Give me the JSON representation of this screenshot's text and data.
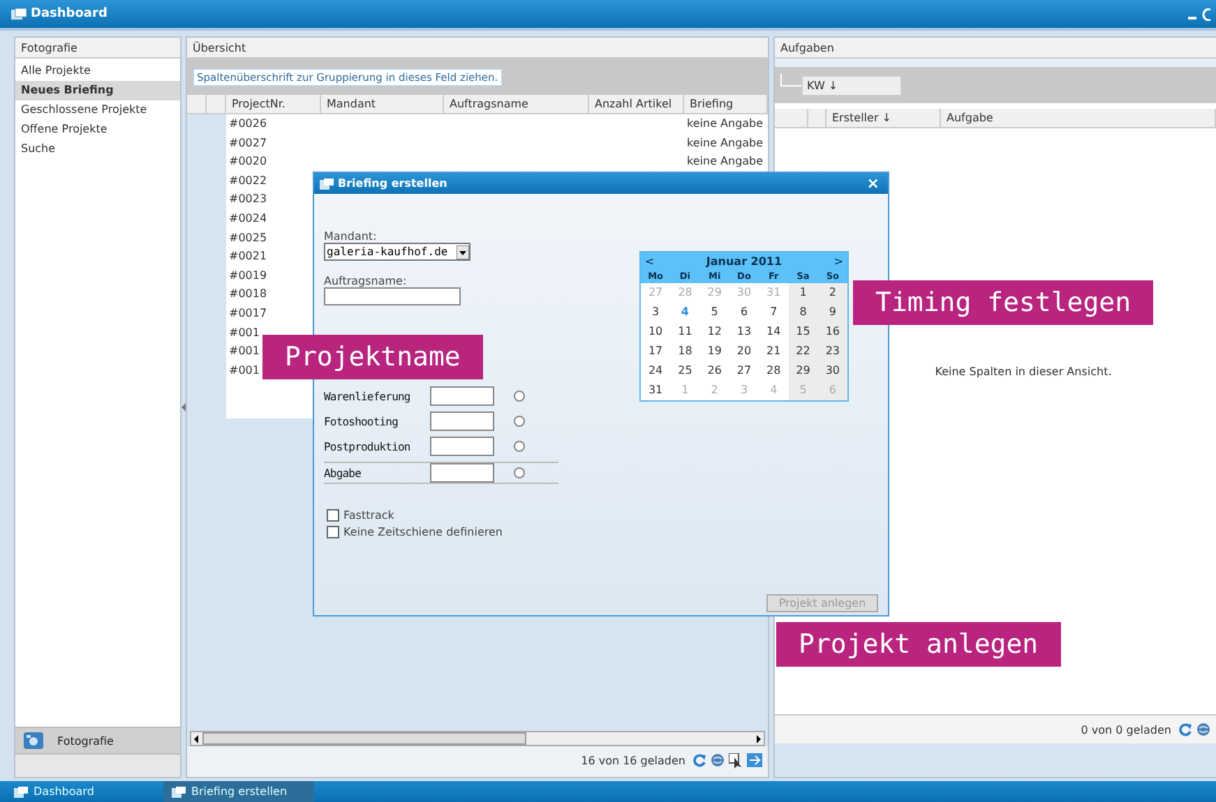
{
  "window": {
    "title": "Dashboard"
  },
  "sidebar": {
    "title": "Fotografie",
    "items": [
      {
        "label": "Alle Projekte",
        "selected": false
      },
      {
        "label": "Neues Briefing",
        "selected": true
      },
      {
        "label": "Geschlossene Projekte",
        "selected": false
      },
      {
        "label": "Offene Projekte",
        "selected": false
      },
      {
        "label": "Suche",
        "selected": false
      }
    ],
    "footer_button": "Fotografie"
  },
  "overview": {
    "title": "Übersicht",
    "group_hint": "Spaltenüberschrift zur Gruppierung in dieses Feld ziehen.",
    "columns": [
      "ProjectNr.",
      "Mandant",
      "Auftragsname",
      "Anzahl Artikel",
      "Briefing"
    ],
    "rows": [
      {
        "project_nr": "#0026",
        "briefing": "keine Angabe"
      },
      {
        "project_nr": "#0027",
        "briefing": "keine Angabe"
      },
      {
        "project_nr": "#0020",
        "briefing": "keine Angabe"
      },
      {
        "project_nr": "#0022"
      },
      {
        "project_nr": "#0023"
      },
      {
        "project_nr": "#0024"
      },
      {
        "project_nr": "#0025"
      },
      {
        "project_nr": "#0021"
      },
      {
        "project_nr": "#0019"
      },
      {
        "project_nr": "#0018"
      },
      {
        "project_nr": "#0017"
      },
      {
        "project_nr": "#001"
      },
      {
        "project_nr": "#001"
      },
      {
        "project_nr": "#001"
      }
    ],
    "status": "16 von 16 geladen"
  },
  "tasks": {
    "title": "Aufgaben",
    "group_chip": "KW ↓",
    "columns": [
      "Ersteller ↓",
      "Aufgabe"
    ],
    "empty_message": "Keine Spalten in dieser Ansicht.",
    "status": "0 von 0 geladen"
  },
  "dialog": {
    "title": "Briefing erstellen",
    "close": "×",
    "mandant_label": "Mandant:",
    "mandant_value": "galeria-kaufhof.de",
    "auftrag_label": "Auftragsname:",
    "phases": [
      {
        "label": "Warenlieferung",
        "selected": false
      },
      {
        "label": "Fotoshooting",
        "selected": false
      },
      {
        "label": "Postproduktion",
        "selected": false
      },
      {
        "label": "Abgabe",
        "selected": false
      }
    ],
    "checkboxes": [
      {
        "label": "Fasttrack",
        "checked": false
      },
      {
        "label": "Keine Zeitschiene definieren",
        "checked": false
      }
    ],
    "submit": {
      "label": "Projekt anlegen",
      "disabled": true
    },
    "calendar": {
      "prev": "<",
      "month": "Januar 2011",
      "next": ">",
      "weekdays": [
        "Mo",
        "Di",
        "Mi",
        "Do",
        "Fr",
        "Sa",
        "So"
      ],
      "weeks": [
        [
          {
            "label": "27",
            "muted": true,
            "today": false
          },
          {
            "label": "28",
            "muted": true,
            "today": false
          },
          {
            "label": "29",
            "muted": true,
            "today": false
          },
          {
            "label": "30",
            "muted": true,
            "today": false
          },
          {
            "label": "31",
            "muted": true,
            "today": false
          },
          {
            "label": "1",
            "muted": false,
            "today": false
          },
          {
            "label": "2",
            "muted": false,
            "today": false
          }
        ],
        [
          {
            "label": "3",
            "muted": false,
            "today": false
          },
          {
            "label": "4",
            "muted": false,
            "today": true
          },
          {
            "label": "5",
            "muted": false,
            "today": false
          },
          {
            "label": "6",
            "muted": false,
            "today": false
          },
          {
            "label": "7",
            "muted": false,
            "today": false
          },
          {
            "label": "8",
            "muted": false,
            "today": false
          },
          {
            "label": "9",
            "muted": false,
            "today": false
          }
        ],
        [
          {
            "label": "10",
            "muted": false,
            "today": false
          },
          {
            "label": "11",
            "muted": false,
            "today": false
          },
          {
            "label": "12",
            "muted": false,
            "today": false
          },
          {
            "label": "13",
            "muted": false,
            "today": false
          },
          {
            "label": "14",
            "muted": false,
            "today": false
          },
          {
            "label": "15",
            "muted": false,
            "today": false
          },
          {
            "label": "16",
            "muted": false,
            "today": false
          }
        ],
        [
          {
            "label": "17",
            "muted": false,
            "today": false
          },
          {
            "label": "18",
            "muted": false,
            "today": false
          },
          {
            "label": "19",
            "muted": false,
            "today": false
          },
          {
            "label": "20",
            "muted": false,
            "today": false
          },
          {
            "label": "21",
            "muted": false,
            "today": false
          },
          {
            "label": "22",
            "muted": false,
            "today": false
          },
          {
            "label": "23",
            "muted": false,
            "today": false
          }
        ],
        [
          {
            "label": "24",
            "muted": false,
            "today": false
          },
          {
            "label": "25",
            "muted": false,
            "today": false
          },
          {
            "label": "26",
            "muted": false,
            "today": false
          },
          {
            "label": "27",
            "muted": false,
            "today": false
          },
          {
            "label": "28",
            "muted": false,
            "today": false
          },
          {
            "label": "29",
            "muted": false,
            "today": false
          },
          {
            "label": "30",
            "muted": false,
            "today": false
          }
        ],
        [
          {
            "label": "31",
            "muted": false,
            "today": false
          },
          {
            "label": "1",
            "muted": true,
            "today": false
          },
          {
            "label": "2",
            "muted": true,
            "today": false
          },
          {
            "label": "3",
            "muted": true,
            "today": false
          },
          {
            "label": "4",
            "muted": true,
            "today": false
          },
          {
            "label": "5",
            "muted": true,
            "today": false
          },
          {
            "label": "6",
            "muted": true,
            "today": false
          }
        ]
      ]
    }
  },
  "callouts": [
    {
      "label": "Projektname"
    },
    {
      "label": "Timing festlegen"
    },
    {
      "label": "Projekt anlegen"
    }
  ],
  "taskbar": [
    {
      "label": "Dashboard",
      "selected": false
    },
    {
      "label": "Briefing erstellen",
      "selected": true
    }
  ]
}
